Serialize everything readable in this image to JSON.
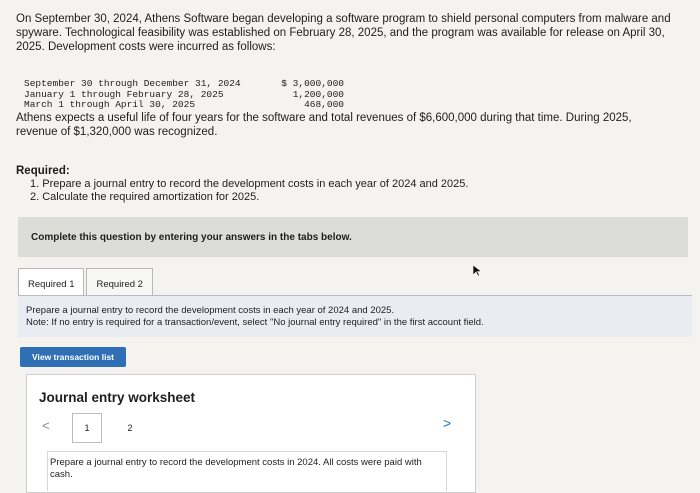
{
  "intro": "On September 30, 2024, Athens Software began developing a software program to shield personal computers from malware and spyware. Technological feasibility was established on February 28, 2025, and the program was available for release on April 30, 2025. Development costs were incurred as follows:",
  "costs": [
    {
      "period": "September 30 through December 31, 2024",
      "amount": "$ 3,000,000"
    },
    {
      "period": "January 1 through February 28, 2025",
      "amount": "1,200,000"
    },
    {
      "period": "March 1 through April 30, 2025",
      "amount": "468,000"
    }
  ],
  "athens": "Athens expects a useful life of four years for the software and total revenues of $6,600,000 during that time. During 2025, revenue of $1,320,000 was recognized.",
  "required_heading": "Required:",
  "required_items": [
    "1. Prepare a journal entry to record the development costs in each year of 2024 and 2025.",
    "2. Calculate the required amortization for 2025."
  ],
  "banner": "Complete this question by entering your answers in the tabs below.",
  "tabs": [
    {
      "label": "Required 1"
    },
    {
      "label": "Required 2"
    }
  ],
  "panel": {
    "line1": "Prepare a journal entry to record the development costs in each year of 2024 and 2025.",
    "note": "Note: If no entry is required for a transaction/event, select \"No journal entry required\" in the first account field."
  },
  "view_button": "View transaction list",
  "worksheet": {
    "title": "Journal entry worksheet",
    "pages": [
      "1",
      "2"
    ],
    "desc": "Prepare a journal entry to record the development costs in 2024. All costs were paid with cash."
  },
  "nav": {
    "left": "<",
    "right": ">"
  }
}
